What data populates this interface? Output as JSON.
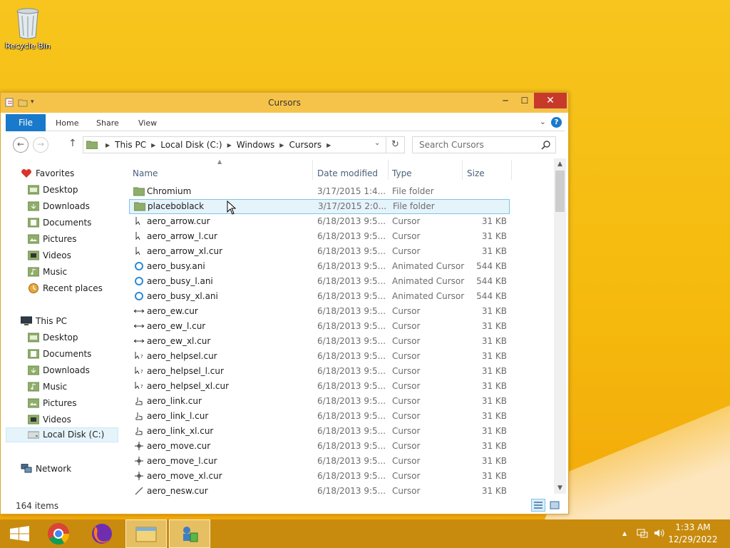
{
  "desktop": {
    "recycle_bin_label": "Recycle Bin"
  },
  "window": {
    "title": "Cursors",
    "controls": {
      "minimize": "─",
      "maximize": "☐",
      "close": "✕"
    }
  },
  "ribbon": {
    "tabs": [
      "File",
      "Home",
      "Share",
      "View"
    ],
    "help": "?"
  },
  "address": {
    "crumbs": [
      "This PC",
      "Local Disk (C:)",
      "Windows",
      "Cursors"
    ]
  },
  "search": {
    "placeholder": "Search Cursors"
  },
  "sidebar": {
    "favorites": {
      "label": "Favorites",
      "items": [
        "Desktop",
        "Downloads",
        "Documents",
        "Pictures",
        "Videos",
        "Music",
        "Recent places"
      ]
    },
    "this_pc": {
      "label": "This PC",
      "items": [
        "Desktop",
        "Documents",
        "Downloads",
        "Music",
        "Pictures",
        "Videos",
        "Local Disk (C:)"
      ]
    },
    "network": {
      "label": "Network"
    }
  },
  "columns": {
    "name": "Name",
    "date": "Date modified",
    "type": "Type",
    "size": "Size"
  },
  "files": [
    {
      "name": "Chromium",
      "date": "3/17/2015 1:4...",
      "type": "File folder",
      "size": "",
      "icon": "folder-icon"
    },
    {
      "name": "placeboblack",
      "date": "3/17/2015 2:0...",
      "type": "File folder",
      "size": "",
      "icon": "folder-icon"
    },
    {
      "name": "aero_arrow.cur",
      "date": "6/18/2013 9:5...",
      "type": "Cursor",
      "size": "31 KB",
      "icon": "arrow-cursor-icon"
    },
    {
      "name": "aero_arrow_l.cur",
      "date": "6/18/2013 9:5...",
      "type": "Cursor",
      "size": "31 KB",
      "icon": "arrow-cursor-icon"
    },
    {
      "name": "aero_arrow_xl.cur",
      "date": "6/18/2013 9:5...",
      "type": "Cursor",
      "size": "31 KB",
      "icon": "arrow-cursor-icon"
    },
    {
      "name": "aero_busy.ani",
      "date": "6/18/2013 9:5...",
      "type": "Animated Cursor",
      "size": "544 KB",
      "icon": "busy-cursor-icon"
    },
    {
      "name": "aero_busy_l.ani",
      "date": "6/18/2013 9:5...",
      "type": "Animated Cursor",
      "size": "544 KB",
      "icon": "busy-cursor-icon"
    },
    {
      "name": "aero_busy_xl.ani",
      "date": "6/18/2013 9:5...",
      "type": "Animated Cursor",
      "size": "544 KB",
      "icon": "busy-cursor-icon"
    },
    {
      "name": "aero_ew.cur",
      "date": "6/18/2013 9:5...",
      "type": "Cursor",
      "size": "31 KB",
      "icon": "resize-ew-cursor-icon"
    },
    {
      "name": "aero_ew_l.cur",
      "date": "6/18/2013 9:5...",
      "type": "Cursor",
      "size": "31 KB",
      "icon": "resize-ew-cursor-icon"
    },
    {
      "name": "aero_ew_xl.cur",
      "date": "6/18/2013 9:5...",
      "type": "Cursor",
      "size": "31 KB",
      "icon": "resize-ew-cursor-icon"
    },
    {
      "name": "aero_helpsel.cur",
      "date": "6/18/2013 9:5...",
      "type": "Cursor",
      "size": "31 KB",
      "icon": "help-cursor-icon"
    },
    {
      "name": "aero_helpsel_l.cur",
      "date": "6/18/2013 9:5...",
      "type": "Cursor",
      "size": "31 KB",
      "icon": "help-cursor-icon"
    },
    {
      "name": "aero_helpsel_xl.cur",
      "date": "6/18/2013 9:5...",
      "type": "Cursor",
      "size": "31 KB",
      "icon": "help-cursor-icon"
    },
    {
      "name": "aero_link.cur",
      "date": "6/18/2013 9:5...",
      "type": "Cursor",
      "size": "31 KB",
      "icon": "hand-cursor-icon"
    },
    {
      "name": "aero_link_l.cur",
      "date": "6/18/2013 9:5...",
      "type": "Cursor",
      "size": "31 KB",
      "icon": "hand-cursor-icon"
    },
    {
      "name": "aero_link_xl.cur",
      "date": "6/18/2013 9:5...",
      "type": "Cursor",
      "size": "31 KB",
      "icon": "hand-cursor-icon"
    },
    {
      "name": "aero_move.cur",
      "date": "6/18/2013 9:5...",
      "type": "Cursor",
      "size": "31 KB",
      "icon": "move-cursor-icon"
    },
    {
      "name": "aero_move_l.cur",
      "date": "6/18/2013 9:5...",
      "type": "Cursor",
      "size": "31 KB",
      "icon": "move-cursor-icon"
    },
    {
      "name": "aero_move_xl.cur",
      "date": "6/18/2013 9:5...",
      "type": "Cursor",
      "size": "31 KB",
      "icon": "move-cursor-icon"
    },
    {
      "name": "aero_nesw.cur",
      "date": "6/18/2013 9:5...",
      "type": "Cursor",
      "size": "31 KB",
      "icon": "resize-nesw-cursor-icon"
    }
  ],
  "selected_row": 1,
  "status": {
    "count": "164 items"
  },
  "taskbar": {
    "clock_time": "1:33 AM",
    "clock_date": "12/29/2022",
    "tray_chevron": "▲",
    "colors": {
      "taskbar": "#c88b0e",
      "accent": "#1979ca"
    }
  }
}
